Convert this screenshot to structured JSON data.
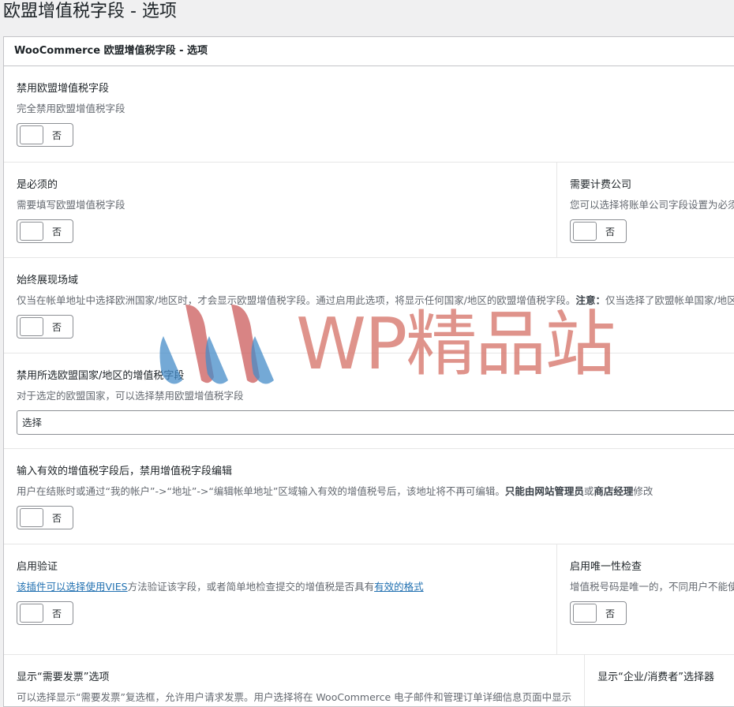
{
  "page": {
    "title": "欧盟增值税字段 - 选项"
  },
  "card": {
    "header": "WooCommerce 欧盟增值税字段 - 选项"
  },
  "sections": {
    "disable_fields": {
      "label": "禁用欧盟增值税字段",
      "desc": "完全禁用欧盟增值税字段",
      "toggle": "否"
    },
    "required": {
      "label": "是必须的",
      "desc": "需要填写欧盟增值税字段",
      "toggle": "否"
    },
    "require_company": {
      "label": "需要计费公司",
      "desc": "您可以选择将账单公司字段设置为必须",
      "toggle": "否"
    },
    "always_show": {
      "label": "始终展现场域",
      "desc_a": "仅当在帐单地址中选择欧洲国家/地区时，才会显示欧盟增值税字段。通过启用此选项，将显示任何国家/地区的欧盟增值税字段。",
      "desc_b": "注意：",
      "desc_c": "仅当选择了欧盟帐单国家/地区时才会检查增值税号。",
      "toggle": "否"
    },
    "disable_countries": {
      "label": "禁用所选欧盟国家/地区的增值税字段",
      "desc": "对于选定的欧盟国家，可以选择禁用欧盟增值税字段",
      "select_value": "选择"
    },
    "disable_edit": {
      "label": "输入有效的增值税字段后，禁用增值税字段编辑",
      "desc_a": "用户在结账时或通过“我的帐户”->“地址”->“编辑帐单地址”区域输入有效的增值税号后，该地址将不再可编辑。",
      "desc_b": "只能由网站管理员",
      "desc_c": "或",
      "desc_d": "商店经理",
      "desc_e": "修改",
      "toggle": "否"
    },
    "validation": {
      "label": "启用验证",
      "link_a": "该插件可以选择使用VIES",
      "desc_mid": "方法验证该字段，或者简单地检查提交的增值税是否具有",
      "link_b": "有效的格式",
      "toggle": "否"
    },
    "uniqueness": {
      "label": "启用唯一性检查",
      "desc": "增值税号码是唯一的，不同用户不能使用相同号码",
      "toggle": "否"
    },
    "invoice": {
      "label": "显示“需要发票”选项",
      "desc": "可以选择显示“需要发票”复选框，允许用户请求发票。用户选择将在 WooCommerce 电子邮件和管理订单详细信息页面中显示"
    },
    "b2b": {
      "label": "显示“企业/消费者”选择器"
    }
  },
  "watermark": {
    "text": "WP精品站"
  }
}
